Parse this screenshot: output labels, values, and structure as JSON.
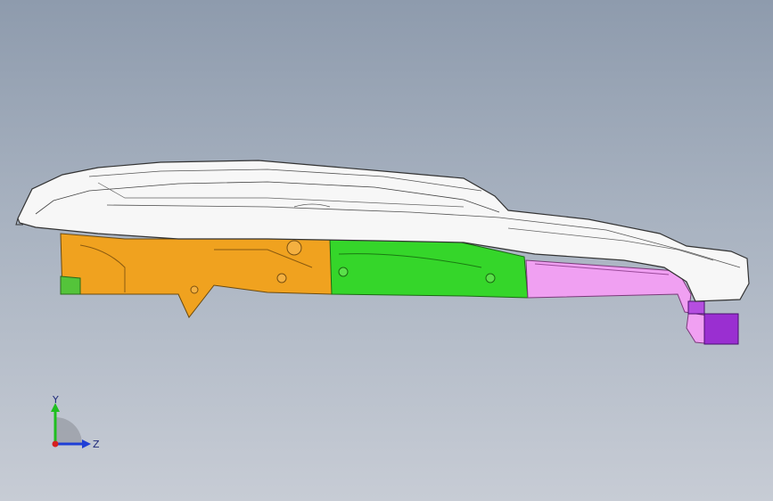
{
  "viewport": {
    "background_top": "#8e9bad",
    "background_bottom": "#c7ccd5"
  },
  "model": {
    "parts": [
      {
        "name": "outer-shell",
        "color": "#f7f7f7"
      },
      {
        "name": "rear-bracket",
        "color": "#f0a21f"
      },
      {
        "name": "mid-rail",
        "color": "#35d62a"
      },
      {
        "name": "front-extension",
        "color": "#f0a0f2"
      },
      {
        "name": "front-clip",
        "color": "#9a2fd1"
      }
    ]
  },
  "triad": {
    "y_label": "Y",
    "z_label": "Z",
    "y_color": "#1fbf1f",
    "z_color": "#1f3fd6",
    "x_color": "#d61f1f"
  }
}
